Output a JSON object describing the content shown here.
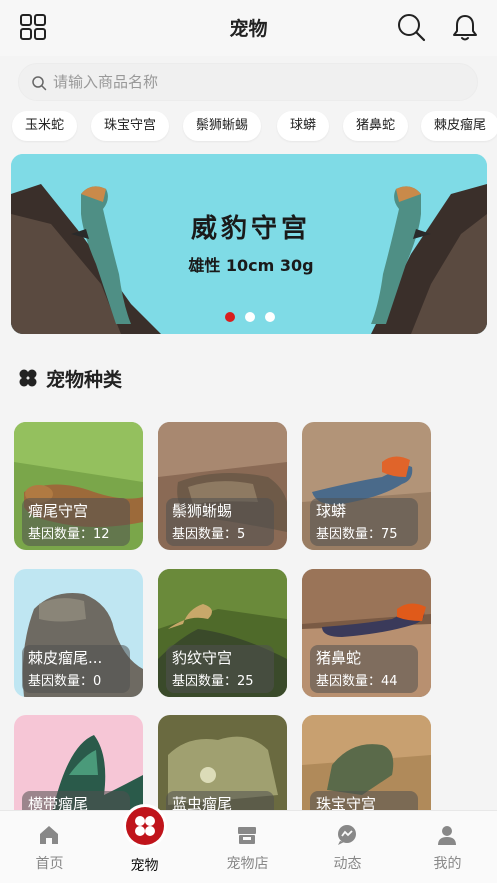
{
  "header": {
    "title": "宠物"
  },
  "search": {
    "placeholder": "请输入商品名称"
  },
  "chips": [
    "玉米蛇",
    "珠宝守宫",
    "鬃狮蜥蜴",
    "球蟒",
    "猪鼻蛇",
    "棘皮瘤尾"
  ],
  "banner": {
    "title": "威豹守宫",
    "subtitle": "雄性 10cm 30g",
    "active_dot": 0,
    "dot_count": 3
  },
  "section": {
    "title": "宠物种类"
  },
  "count_prefix": "基因数量：",
  "pets": [
    {
      "name": "瘤尾守宫",
      "count": "12"
    },
    {
      "name": "鬃狮蜥蜴",
      "count": "5"
    },
    {
      "name": "球蟒",
      "count": "75"
    },
    {
      "name": "棘皮瘤尾...",
      "count": "0"
    },
    {
      "name": "豹纹守宫",
      "count": "25"
    },
    {
      "name": "猪鼻蛇",
      "count": "44"
    },
    {
      "name": "横带瘤尾",
      "count": ""
    },
    {
      "name": "蓝虫瘤尾",
      "count": ""
    },
    {
      "name": "珠宝守宫",
      "count": ""
    }
  ],
  "nav": [
    {
      "label": "首页",
      "icon": "home-icon"
    },
    {
      "label": "宠物",
      "icon": "pet-icon"
    },
    {
      "label": "宠物店",
      "icon": "store-icon"
    },
    {
      "label": "动态",
      "icon": "message-icon"
    },
    {
      "label": "我的",
      "icon": "user-icon"
    }
  ],
  "colors": {
    "accent": "#c0141b",
    "banner_bg": "#7fdbe6"
  }
}
